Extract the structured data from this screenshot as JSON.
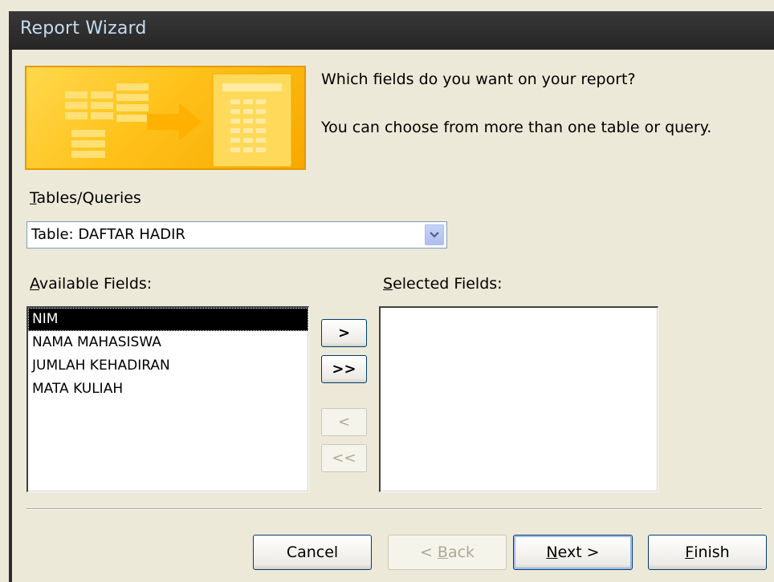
{
  "window": {
    "title": "Report Wizard"
  },
  "prompt": {
    "line1": "Which fields do you want on your report?",
    "line2": "You can choose from more than one table or query."
  },
  "tables_queries": {
    "label_accel": "T",
    "label_rest": "ables/Queries",
    "value": "Table: DAFTAR HADIR"
  },
  "available_fields": {
    "label_accel": "A",
    "label_rest": "vailable Fields:",
    "items": [
      "NIM",
      "NAMA MAHASISWA",
      "JUMLAH KEHADIRAN",
      "MATA KULIAH"
    ],
    "selected_index": 0
  },
  "selected_fields": {
    "label_accel": "S",
    "label_rest": "elected Fields:",
    "items": []
  },
  "move_buttons": {
    "add_one": ">",
    "add_all": ">>",
    "remove_one": "<",
    "remove_all": "<<"
  },
  "footer_buttons": {
    "cancel": "Cancel",
    "back_pre": "< ",
    "back_accel": "B",
    "back_rest": "ack",
    "next_accel": "N",
    "next_rest": "ext >",
    "finish_accel": "F",
    "finish_rest": "inish"
  },
  "colors": {
    "titlebar": "#2e2e2e",
    "title_text": "#c7dbef",
    "dialog_bg": "#ece9d8",
    "illustration_bg": "#ffc21a",
    "selection_bg": "#000000"
  }
}
